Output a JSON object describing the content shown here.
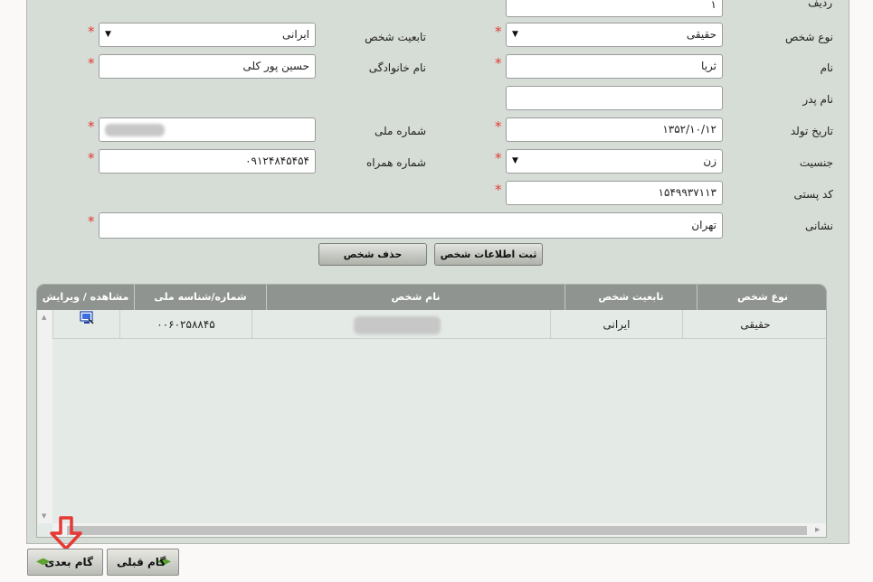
{
  "form": {
    "row_label": "ردیف",
    "row_value": "۱",
    "person_type": {
      "label": "نوع شخص",
      "value": "حقیقی"
    },
    "nationality": {
      "label": "تابعیت شخص",
      "value": "ایرانی"
    },
    "first_name": {
      "label": "نام",
      "value": "ثریا"
    },
    "last_name": {
      "label": "نام خانوادگی",
      "value": "حسین پور کلی"
    },
    "father_name": {
      "label": "نام پدر",
      "value": ""
    },
    "birth_date": {
      "label": "تاریخ تولد",
      "value": "۱۳۵۲/۱۰/۱۲"
    },
    "national_id": {
      "label": "شماره ملی",
      "value": ""
    },
    "gender": {
      "label": "جنسیت",
      "value": "زن"
    },
    "mobile": {
      "label": "شماره همراه",
      "value": "۰۹۱۲۴۸۴۵۴۵۴"
    },
    "postal_code": {
      "label": "کد پستی",
      "value": "۱۵۴۹۹۳۷۱۱۳"
    },
    "address": {
      "label": "نشانی",
      "value": "تهران"
    },
    "required_mark": "*",
    "dropdown_icon": "▼"
  },
  "buttons": {
    "save_person": "ثبت اطلاعات شخص",
    "delete_person": "حذف شخص",
    "prev_step": "گام قبلی",
    "next_step": "گام بعدی"
  },
  "table": {
    "columns": [
      "نوع شخص",
      "تابعیت شخص",
      "نام شخص",
      "شماره/شناسه ملی",
      "مشاهده / ویرایش"
    ],
    "rows": [
      {
        "type": "حقیقی",
        "nationality": "ایرانی",
        "name": "",
        "national_id": "۰۰۶۰۲۵۸۸۴۵",
        "action_icon": "monitor-edit-icon"
      }
    ]
  },
  "annotation": {
    "icon": "red-down-arrow-icon",
    "color": "#e53935"
  },
  "colors": {
    "accent_green": "#5aa02c",
    "header_gray": "#8f9490"
  }
}
